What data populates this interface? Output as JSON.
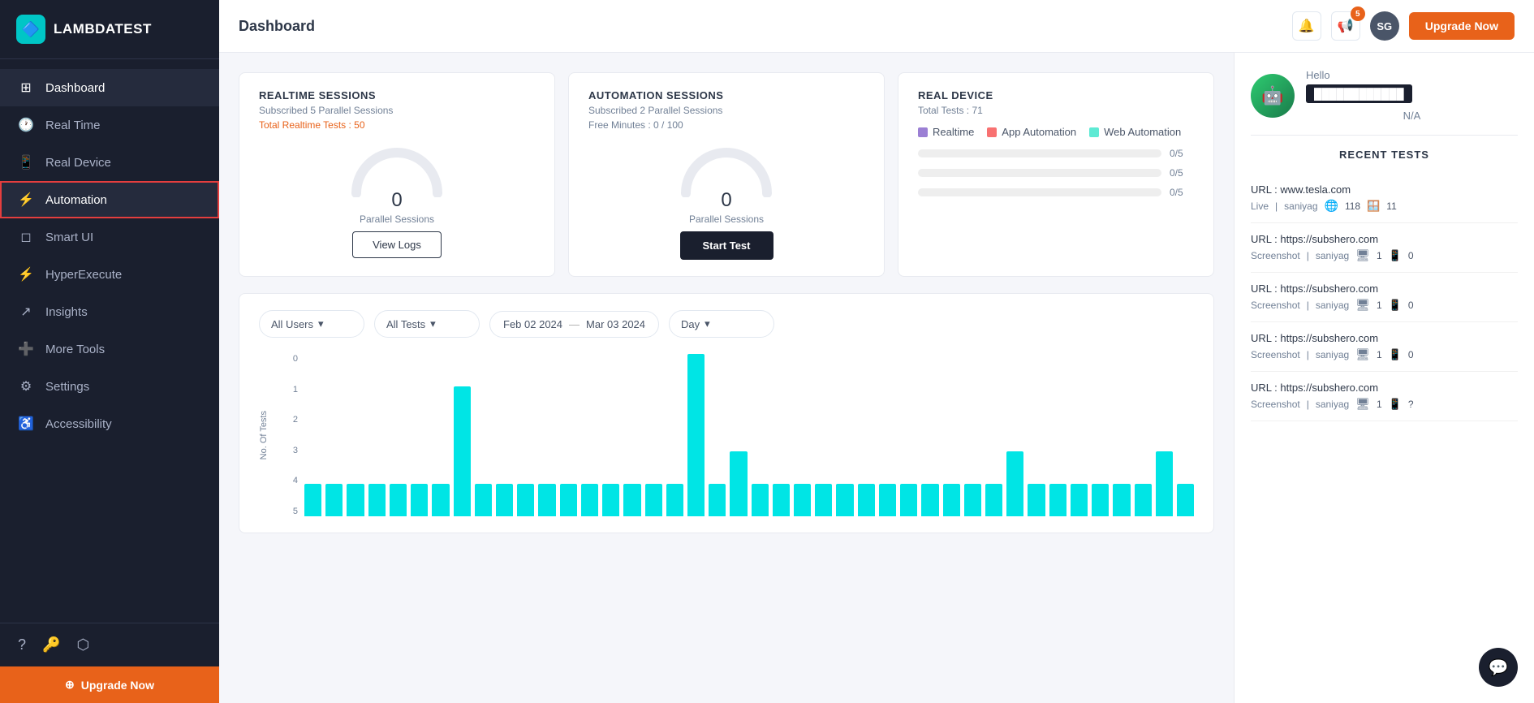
{
  "sidebar": {
    "logo_text": "LAMBDATEST",
    "nav_items": [
      {
        "id": "dashboard",
        "label": "Dashboard",
        "icon": "⊞",
        "active": true
      },
      {
        "id": "realtime",
        "label": "Real Time",
        "icon": "🕐",
        "active": false
      },
      {
        "id": "realdevice",
        "label": "Real Device",
        "icon": "📱",
        "active": false
      },
      {
        "id": "automation",
        "label": "Automation",
        "icon": "⚡",
        "active": false,
        "highlighted": true
      },
      {
        "id": "smartui",
        "label": "Smart UI",
        "icon": "◻",
        "active": false
      },
      {
        "id": "hyperexecute",
        "label": "HyperExecute",
        "icon": "⚡",
        "active": false
      },
      {
        "id": "insights",
        "label": "Insights",
        "icon": "↗",
        "active": false
      },
      {
        "id": "moretools",
        "label": "More Tools",
        "icon": "➕",
        "active": false
      },
      {
        "id": "settings",
        "label": "Settings",
        "icon": "⚙",
        "active": false
      },
      {
        "id": "accessibility",
        "label": "Accessibility",
        "icon": "♿",
        "active": false
      }
    ],
    "upgrade_label": "Upgrade Now"
  },
  "header": {
    "title": "Dashboard",
    "notification_count": "5",
    "avatar_initials": "SG",
    "upgrade_label": "Upgrade Now"
  },
  "profile": {
    "hello": "Hello",
    "name_bar": "████████████",
    "na": "N/A"
  },
  "realtime_sessions": {
    "title": "REALTIME SESSIONS",
    "subtitle": "Subscribed 5 Parallel Sessions",
    "total_label": "Total Realtime Tests : 50",
    "gauge_value": "0",
    "gauge_label": "Parallel Sessions",
    "view_logs": "View Logs"
  },
  "automation_sessions": {
    "title": "AUTOMATION SESSIONS",
    "subtitle": "Subscribed 2 Parallel Sessions",
    "free_minutes": "Free Minutes : 0 / 100",
    "gauge_value": "0",
    "gauge_label": "Parallel Sessions",
    "start_test": "Start Test"
  },
  "real_device": {
    "title": "REAL DEVICE",
    "total": "Total Tests : 71",
    "legends": [
      {
        "label": "Realtime",
        "color": "#9b7fd4"
      },
      {
        "label": "App Automation",
        "color": "#f87171"
      },
      {
        "label": "Web Automation",
        "color": "#5eead4"
      }
    ],
    "bars": [
      {
        "value": "0/5",
        "color": "#c4b5fd",
        "pct": 0
      },
      {
        "value": "0/5",
        "color": "#fca5a5",
        "pct": 0
      },
      {
        "value": "0/5",
        "color": "#99f6e4",
        "pct": 0
      }
    ]
  },
  "filters": {
    "users": "All Users",
    "tests": "All Tests",
    "date_from": "Feb 02 2024",
    "date_to": "Mar 03 2024",
    "groupby": "Day"
  },
  "chart": {
    "y_labels": [
      "5",
      "4",
      "3",
      "2",
      "1",
      "0"
    ],
    "y_axis_label": "No. Of Tests",
    "bars": [
      1,
      1,
      1,
      1,
      1,
      1,
      1,
      4,
      1,
      1,
      1,
      1,
      1,
      1,
      1,
      1,
      1,
      1,
      5,
      1,
      2,
      1,
      1,
      1,
      1,
      1,
      1,
      1,
      1,
      1,
      1,
      1,
      1,
      2,
      1,
      1,
      1,
      1,
      1,
      1,
      2,
      1
    ]
  },
  "recent_tests": {
    "title": "RECENT TESTS",
    "items": [
      {
        "url": "URL : www.tesla.com",
        "type": "Live",
        "user": "saniyag",
        "browser": "chrome",
        "browser_count": "118",
        "device": "windows",
        "device_count": "11"
      },
      {
        "url": "URL : https://subshero.com",
        "type": "Screenshot",
        "user": "saniyag",
        "browser": "desktop",
        "browser_count": "1",
        "device": "mobile",
        "device_count": "0"
      },
      {
        "url": "URL : https://subshero.com",
        "type": "Screenshot",
        "user": "saniyag",
        "browser": "desktop",
        "browser_count": "1",
        "device": "mobile",
        "device_count": "0"
      },
      {
        "url": "URL : https://subshero.com",
        "type": "Screenshot",
        "user": "saniyag",
        "browser": "desktop",
        "browser_count": "1",
        "device": "mobile",
        "device_count": "0"
      },
      {
        "url": "URL : https://subshero.com",
        "type": "Screenshot",
        "user": "saniyag",
        "browser": "desktop",
        "browser_count": "1",
        "device": "mobile",
        "device_count": "?"
      }
    ]
  },
  "colors": {
    "accent_orange": "#e8621a",
    "sidebar_bg": "#1a1f2e",
    "cyan": "#00e5e5",
    "realtime_gauge": "#c4b5fd",
    "automation_gauge": "#fca5a5"
  }
}
